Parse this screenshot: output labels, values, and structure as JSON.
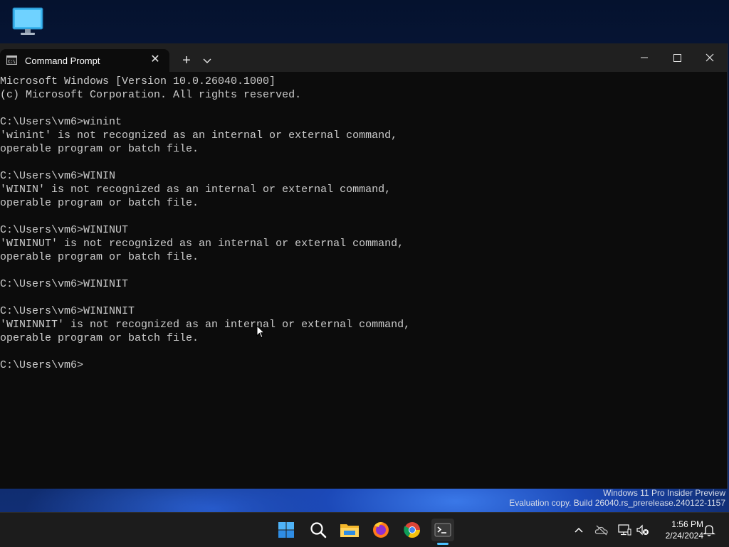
{
  "desktop": {
    "watermark_line1": "Windows 11 Pro Insider Preview",
    "watermark_line2": "Evaluation copy. Build 26040.rs_prerelease.240122-1157"
  },
  "window": {
    "tab_title": "Command Prompt",
    "tab_close": "✕",
    "new_tab": "+",
    "console_lines": [
      "Microsoft Windows [Version 10.0.26040.1000]",
      "(c) Microsoft Corporation. All rights reserved.",
      "",
      "C:\\Users\\vm6>winint",
      "'winint' is not recognized as an internal or external command,",
      "operable program or batch file.",
      "",
      "C:\\Users\\vm6>WININ",
      "'WININ' is not recognized as an internal or external command,",
      "operable program or batch file.",
      "",
      "C:\\Users\\vm6>WININUT",
      "'WININUT' is not recognized as an internal or external command,",
      "operable program or batch file.",
      "",
      "C:\\Users\\vm6>WININIT",
      "",
      "C:\\Users\\vm6>WININNIT",
      "'WININNIT' is not recognized as an internal or external command,",
      "operable program or batch file.",
      "",
      "C:\\Users\\vm6>"
    ]
  },
  "taskbar": {
    "apps": [
      "start-icon",
      "search-icon",
      "file-explorer-icon",
      "firefox-icon",
      "chrome-icon",
      "terminal-icon"
    ],
    "active_app": "terminal",
    "tray_icons": [
      "chevron-up-icon",
      "onedrive-icon",
      "network-icon",
      "volume-muted-icon",
      "notification-bell-icon"
    ],
    "time": "1:56 PM",
    "date": "2/24/2024"
  },
  "colors": {
    "console_bg": "#0c0c0c",
    "console_text": "#cccccc",
    "titlebar_bg": "#202020",
    "taskbar_bg": "#1c1c1c",
    "accent": "#4cc2ff"
  }
}
